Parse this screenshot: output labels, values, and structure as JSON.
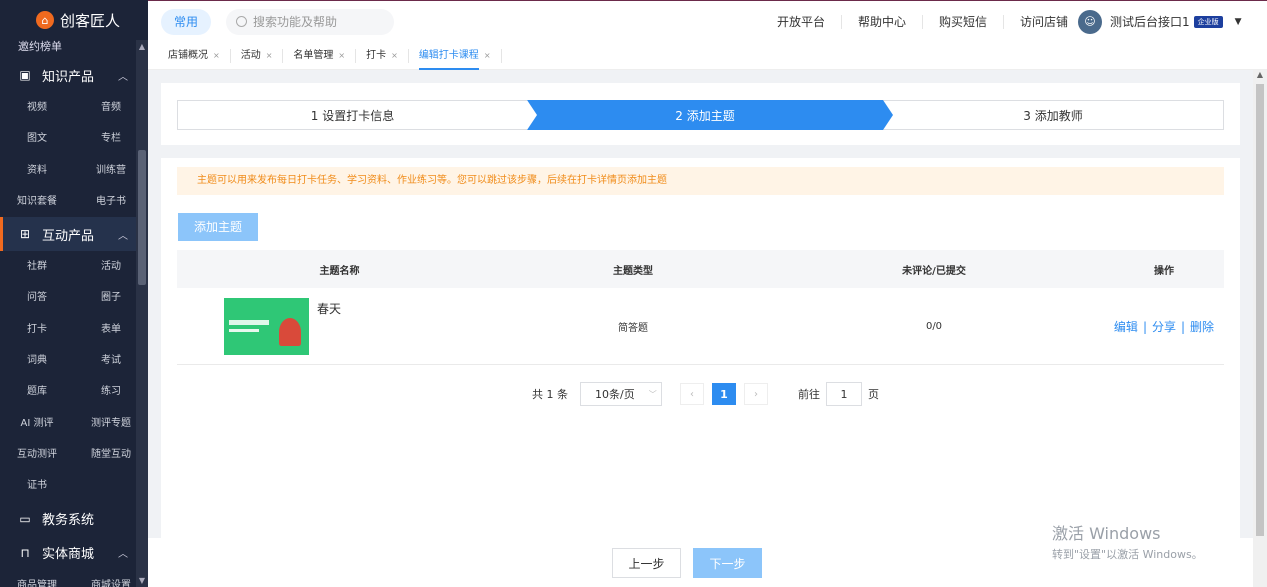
{
  "sidebar": {
    "logo": "创客匠人",
    "top_item": "邀约榜单",
    "groups": [
      {
        "label": "知识产品",
        "items": [
          "视频",
          "音频",
          "图文",
          "专栏",
          "资料",
          "训练营",
          "知识套餐",
          "电子书"
        ]
      },
      {
        "label": "互动产品",
        "items": [
          "社群",
          "活动",
          "问答",
          "圈子",
          "打卡",
          "表单",
          "词典",
          "考试",
          "题库",
          "练习",
          "AI 测评",
          "测评专题",
          "互动测评",
          "随堂互动",
          "证书"
        ]
      },
      {
        "label": "教务系统"
      },
      {
        "label": "实体商城",
        "items": [
          "商品管理",
          "商城设置"
        ]
      }
    ]
  },
  "topbar": {
    "common": "常用",
    "search_placeholder": "搜索功能及帮助",
    "links": [
      "开放平台",
      "帮助中心",
      "购买短信",
      "访问店铺"
    ],
    "user_name": "测试后台接口1",
    "badge": "企业版"
  },
  "tabs": [
    {
      "label": "店铺概况"
    },
    {
      "label": "活动"
    },
    {
      "label": "名单管理"
    },
    {
      "label": "打卡"
    },
    {
      "label": "编辑打卡课程"
    }
  ],
  "steps": [
    "1 设置打卡信息",
    "2 添加主题",
    "3 添加教师"
  ],
  "notice": "主题可以用来发布每日打卡任务、学习资料、作业练习等。您可以跳过该步骤，后续在打卡详情页添加主题",
  "add_button": "添加主题",
  "table": {
    "headers": [
      "主题名称",
      "主题类型",
      "未评论/已提交",
      "操作"
    ],
    "rows": [
      {
        "name": "春天",
        "type": "简答题",
        "counts": "0/0",
        "ops": [
          "编辑",
          "分享",
          "删除"
        ]
      }
    ]
  },
  "pagination": {
    "total": "共 1 条",
    "page_size": "10条/页",
    "current": "1",
    "goto_label": "前往",
    "goto_value": "1",
    "page_unit": "页"
  },
  "footer": {
    "prev": "上一步",
    "next": "下一步"
  },
  "watermark": {
    "line1": "激活 Windows",
    "line2": "转到\"设置\"以激活 Windows。"
  }
}
